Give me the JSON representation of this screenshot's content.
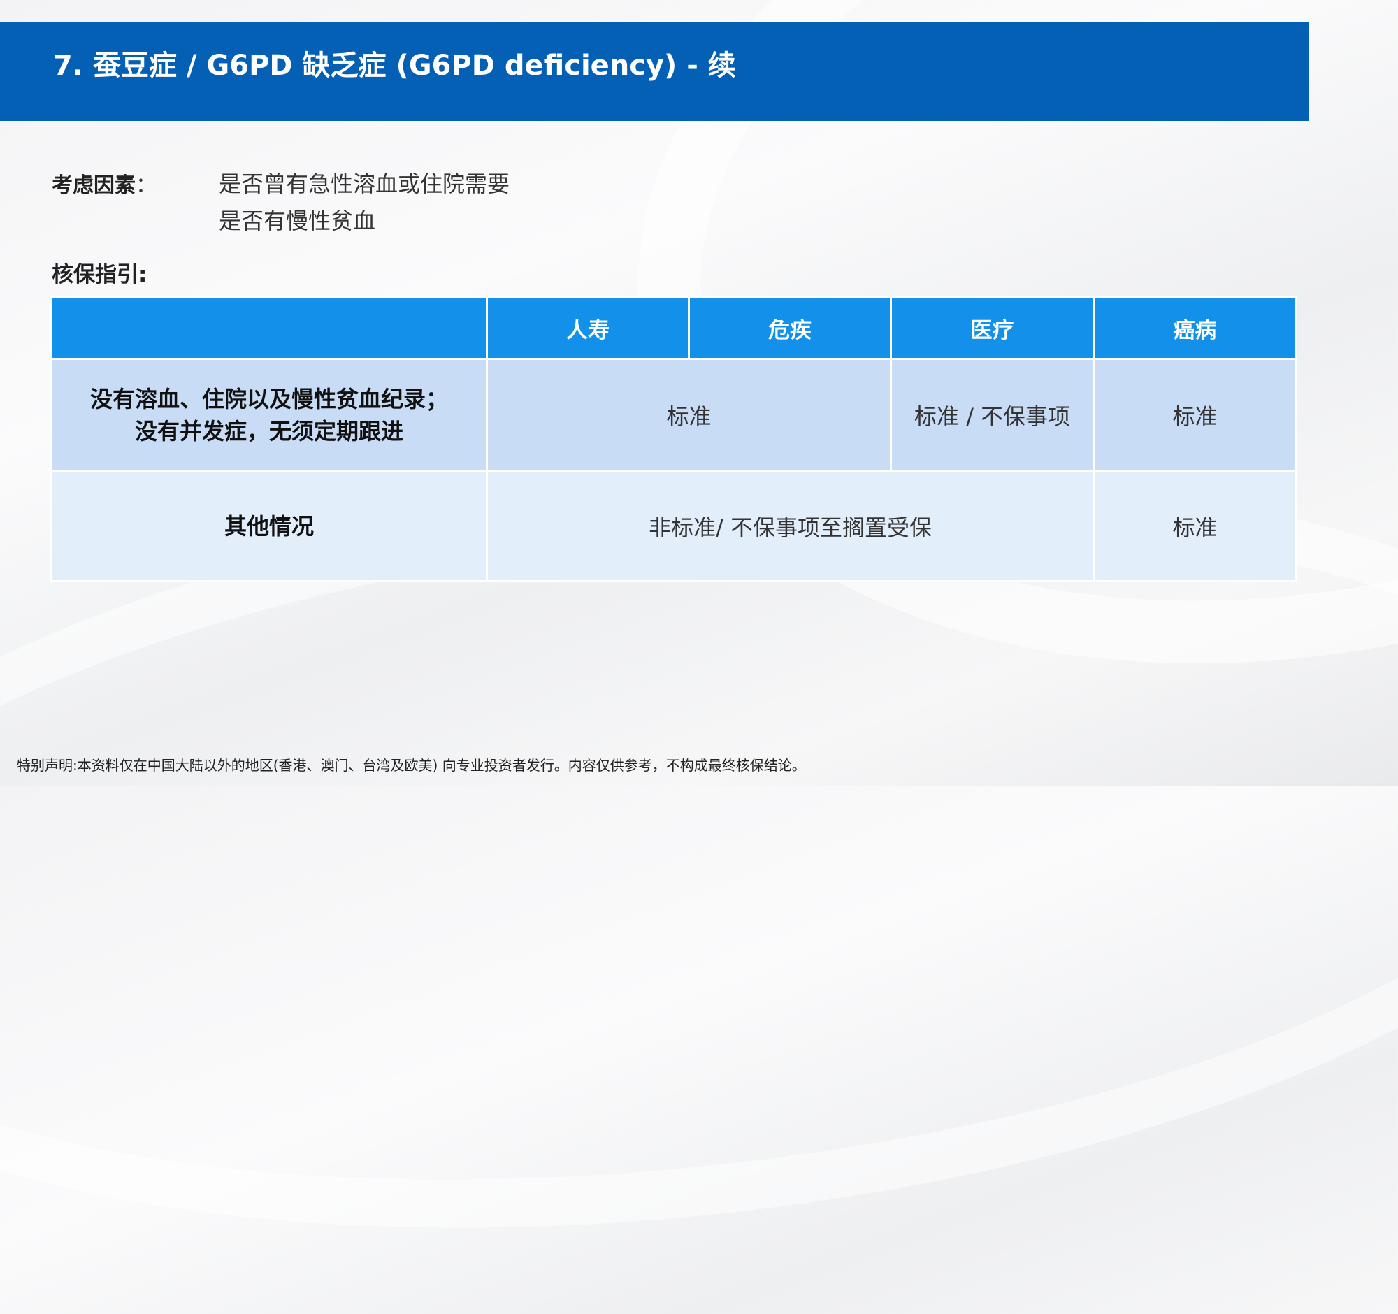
{
  "title": "7. 蚕豆症 / G6PD 缺乏症 (G6PD deficiency) - 续",
  "factors": {
    "label": "考虑因素",
    "sep": "：",
    "items": [
      "是否曾有急性溶血或住院需要",
      "是否有慢性贫血"
    ]
  },
  "guide_label": "核保指引:",
  "table": {
    "headers": [
      "",
      "人寿",
      "危疾",
      "医疗",
      "癌病"
    ],
    "row1": {
      "label_line1": "没有溶血、住院以及慢性贫血纪录；",
      "label_line2": "没有并发症，无须定期跟进",
      "life_ci": "标准",
      "medical": "标准 / 不保事项",
      "cancer": "标准"
    },
    "row2": {
      "label": "其他情况",
      "life_ci_medical": "非标准/ 不保事项至搁置受保",
      "cancer": "标准"
    }
  },
  "footer": "特别声明:本资料仅在中国大陆以外的地区(香港、澳门、台湾及欧美) 向专业投资者发行。内容仅供参考，不构成最终核保结论。",
  "colors": {
    "title_bar": "#0460b4",
    "table_header": "#1290ea",
    "row1_bg": "#c9dcf6",
    "row2_bg": "#e3eefb"
  }
}
